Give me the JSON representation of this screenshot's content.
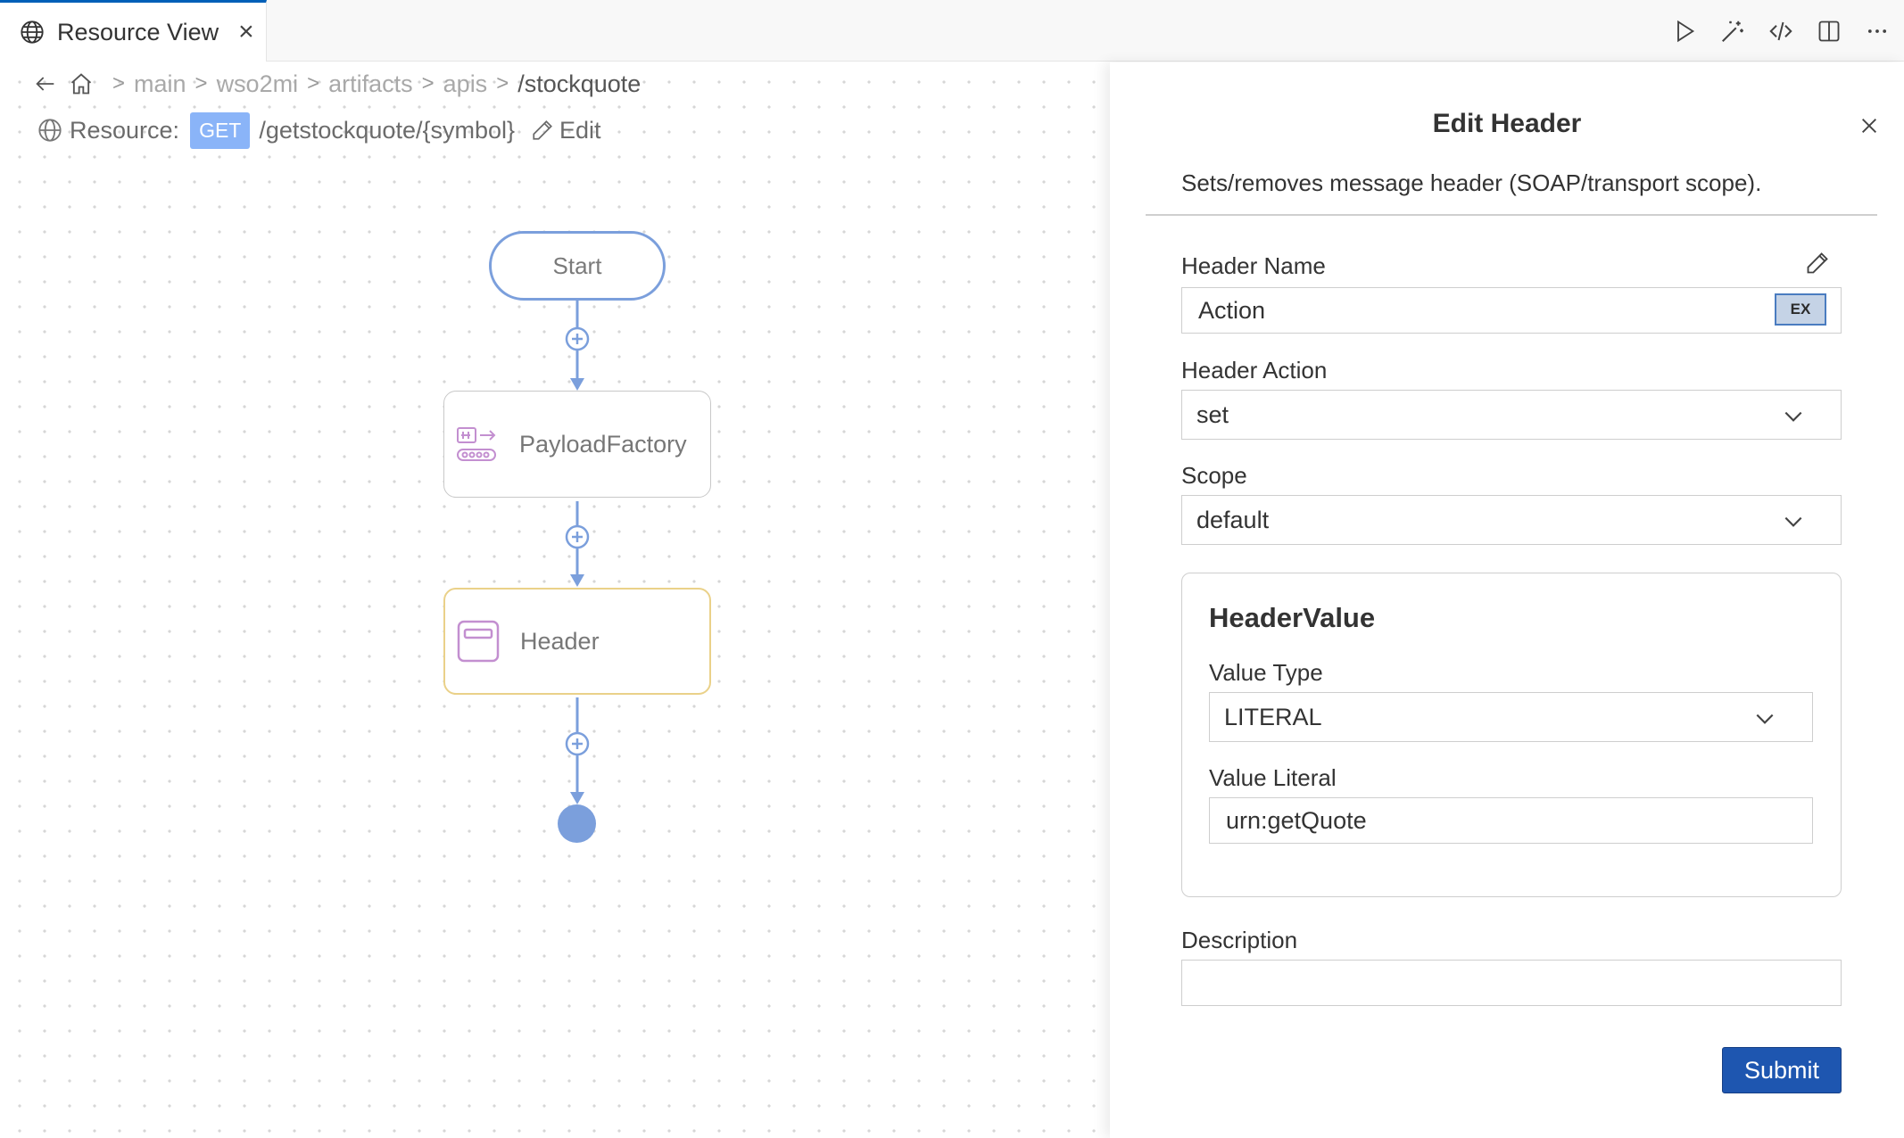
{
  "tab": {
    "title": "Resource View",
    "close": "×"
  },
  "toolbar": {
    "icons": [
      "play-icon",
      "magic-wand-icon",
      "code-icon",
      "split-view-icon",
      "more-icon"
    ]
  },
  "breadcrumb": {
    "items": [
      "main",
      "wso2mi",
      "artifacts",
      "apis"
    ],
    "current": "/stockquote",
    "separator": ">"
  },
  "resource": {
    "label": "Resource:",
    "method": "GET",
    "path": "/getstockquote/{symbol}",
    "edit_label": "Edit"
  },
  "diagram": {
    "start_label": "Start",
    "nodes": [
      {
        "label": "PayloadFactory"
      },
      {
        "label": "Header"
      }
    ],
    "colors": {
      "connector": "#7b9fdc",
      "header_border": "#ead189",
      "icon": "#c38fd0"
    }
  },
  "panel": {
    "title": "Edit Header",
    "description": "Sets/removes message header (SOAP/transport scope).",
    "header_name": {
      "label": "Header Name",
      "value": "Action",
      "ex_label": "EX"
    },
    "header_action": {
      "label": "Header Action",
      "value": "set"
    },
    "scope": {
      "label": "Scope",
      "value": "default"
    },
    "header_value": {
      "title": "HeaderValue",
      "value_type": {
        "label": "Value Type",
        "value": "LITERAL"
      },
      "value_literal": {
        "label": "Value Literal",
        "value": "urn:getQuote"
      }
    },
    "description_field": {
      "label": "Description",
      "value": ""
    },
    "submit_label": "Submit"
  }
}
